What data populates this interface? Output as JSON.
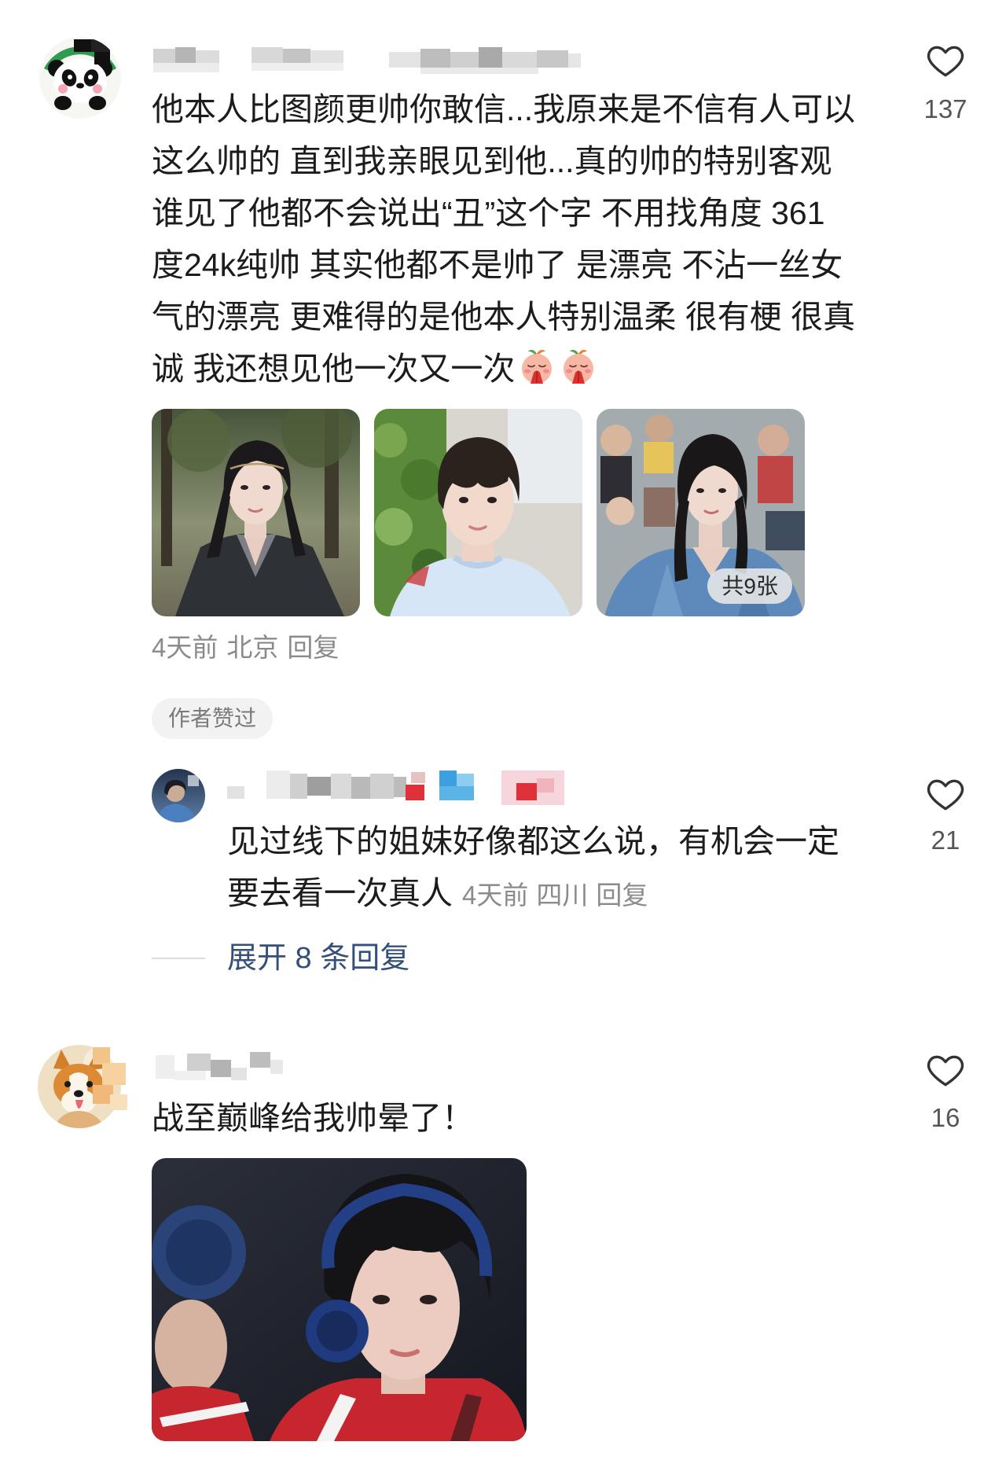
{
  "comments": [
    {
      "text_lines": [
        "他本人比图颜更帅你敢信...我原来是不信有人可以",
        "这么帅的 直到我亲眼见到他...真的帅的特别客观",
        "谁见了他都不会说出“丑”这个字 不用找角度 361",
        "度24k纯帅 其实他都不是帅了 是漂亮 不沾一丝女",
        "气的漂亮 更难得的是他本人特别温柔 很有梗 很真",
        "诚 我还想见他一次又一次"
      ],
      "emojis": [
        "praying-face-emoji",
        "praying-face-emoji"
      ],
      "like_count": "137",
      "image_badge": "共9张",
      "meta": {
        "time": "4天前",
        "location": "北京",
        "reply": "回复"
      },
      "author_liked": "作者赞过",
      "replies": [
        {
          "text_lines": [
            "见过线下的姐妹好像都这么说，有机会一定",
            "要去看一次真人"
          ],
          "like_count": "21",
          "meta": {
            "time": "4天前",
            "location": "四川",
            "reply": "回复"
          }
        }
      ],
      "expand_replies": "展开 8 条回复"
    },
    {
      "text_lines": [
        "战至巅峰给我帅晕了！"
      ],
      "like_count": "16"
    }
  ],
  "icons": {
    "like": "heart-icon",
    "emoji": "praying-face-emoji"
  },
  "colors": {
    "text": "#1c1c1c",
    "meta": "#8b8b8b",
    "like_count": "#555555",
    "expand_link": "#34507a",
    "pill_bg": "#f2f2f2",
    "pill_text": "#7a7a7a"
  }
}
